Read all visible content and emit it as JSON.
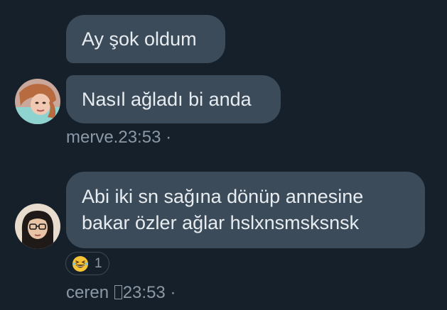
{
  "messages": [
    {
      "text": "Ay şok oldum"
    },
    {
      "text": "Nasıl ağladı bi anda"
    },
    {
      "lines": [
        "Abi iki sn sağına dönüp annesine",
        "bakar özler ağlar hslxnsmsksnsk"
      ]
    }
  ],
  "meta": [
    {
      "sender": "merve.",
      "time": "23:53",
      "dot": "·"
    },
    {
      "sender": "ceren ",
      "time": "23:53",
      "dot": "·"
    }
  ],
  "reaction": {
    "emoji": "grinning-squinting-face",
    "count": "1"
  },
  "colors": {
    "background": "#15202b",
    "bubble": "#3c4b5a",
    "text": "#e7ecf0",
    "meta": "#8b98a5"
  }
}
